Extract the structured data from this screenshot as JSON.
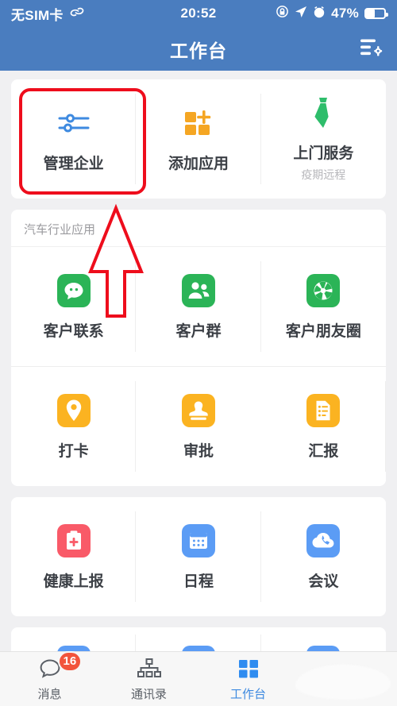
{
  "statusbar": {
    "carrier": "无SIM卡",
    "link_icon": "link-icon",
    "time": "20:52",
    "rotation_icon": "rotation-lock-icon",
    "location_icon": "location-arrow-icon",
    "alarm_icon": "alarm-clock-icon",
    "battery_text": "47%",
    "battery_level": 47
  },
  "header": {
    "title": "工作台",
    "settings_icon": "list-settings-icon"
  },
  "cards": [
    {
      "section_title": null,
      "items": [
        {
          "label": "管理企业",
          "sub": "",
          "icon": "sliders-icon",
          "color": "#3e8ae0",
          "style": "plain"
        },
        {
          "label": "添加应用",
          "sub": "",
          "icon": "add-app-grid-icon",
          "color": "#f5a623",
          "style": "plain"
        },
        {
          "label": "上门服务",
          "sub": "疫期远程",
          "icon": "necktie-icon",
          "color": "#2ebd6b",
          "style": "plain"
        }
      ]
    },
    {
      "section_title": "汽车行业应用",
      "items": [
        {
          "label": "客户联系",
          "sub": "",
          "icon": "chat-bubble-icon",
          "color": "#2bb457",
          "style": "tile"
        },
        {
          "label": "客户群",
          "sub": "",
          "icon": "people-group-icon",
          "color": "#2bb457",
          "style": "tile"
        },
        {
          "label": "客户朋友圈",
          "sub": "",
          "icon": "aperture-icon",
          "color": "#2bb457",
          "style": "tile"
        },
        {
          "label": "打卡",
          "sub": "",
          "icon": "location-pin-icon",
          "color": "#fbb321",
          "style": "tile"
        },
        {
          "label": "审批",
          "sub": "",
          "icon": "stamp-icon",
          "color": "#fbb321",
          "style": "tile"
        },
        {
          "label": "汇报",
          "sub": "",
          "icon": "report-doc-icon",
          "color": "#fbb321",
          "style": "tile"
        }
      ]
    },
    {
      "section_title": null,
      "items": [
        {
          "label": "健康上报",
          "sub": "",
          "icon": "health-clipboard-icon",
          "color": "#f95a68",
          "style": "tile"
        },
        {
          "label": "日程",
          "sub": "",
          "icon": "calendar-icon",
          "color": "#5b9cf5",
          "style": "tile"
        },
        {
          "label": "会议",
          "sub": "",
          "icon": "cloud-phone-icon",
          "color": "#5b9cf5",
          "style": "tile"
        }
      ]
    },
    {
      "section_title": null,
      "partial": true,
      "items": [
        {
          "label": "",
          "sub": "",
          "icon": "phone-icon",
          "color": "#5b9cf5",
          "style": "tile"
        },
        {
          "label": "",
          "sub": "",
          "icon": "word-doc-icon",
          "color": "#5b9cf5",
          "style": "tile"
        },
        {
          "label": "",
          "sub": "",
          "icon": "cube-box-icon",
          "color": "#5b9cf5",
          "style": "tile"
        }
      ]
    }
  ],
  "annotations": {
    "highlight_color": "#ee0d1c",
    "highlight_target": "管理企业",
    "arrow_color": "#ee0d1c",
    "arrow_direction": "up"
  },
  "tabbar": {
    "tabs": [
      {
        "label": "消息",
        "icon": "chat-outline-icon",
        "badge": "16",
        "active": false
      },
      {
        "label": "通讯录",
        "icon": "org-chart-icon",
        "badge": "",
        "active": false
      },
      {
        "label": "工作台",
        "icon": "grid-squares-icon",
        "badge": "",
        "active": true
      },
      {
        "label": "",
        "icon": "",
        "badge": "",
        "active": false
      }
    ],
    "active_color": "#3e8ae0",
    "inactive_color": "#5a5f66"
  }
}
